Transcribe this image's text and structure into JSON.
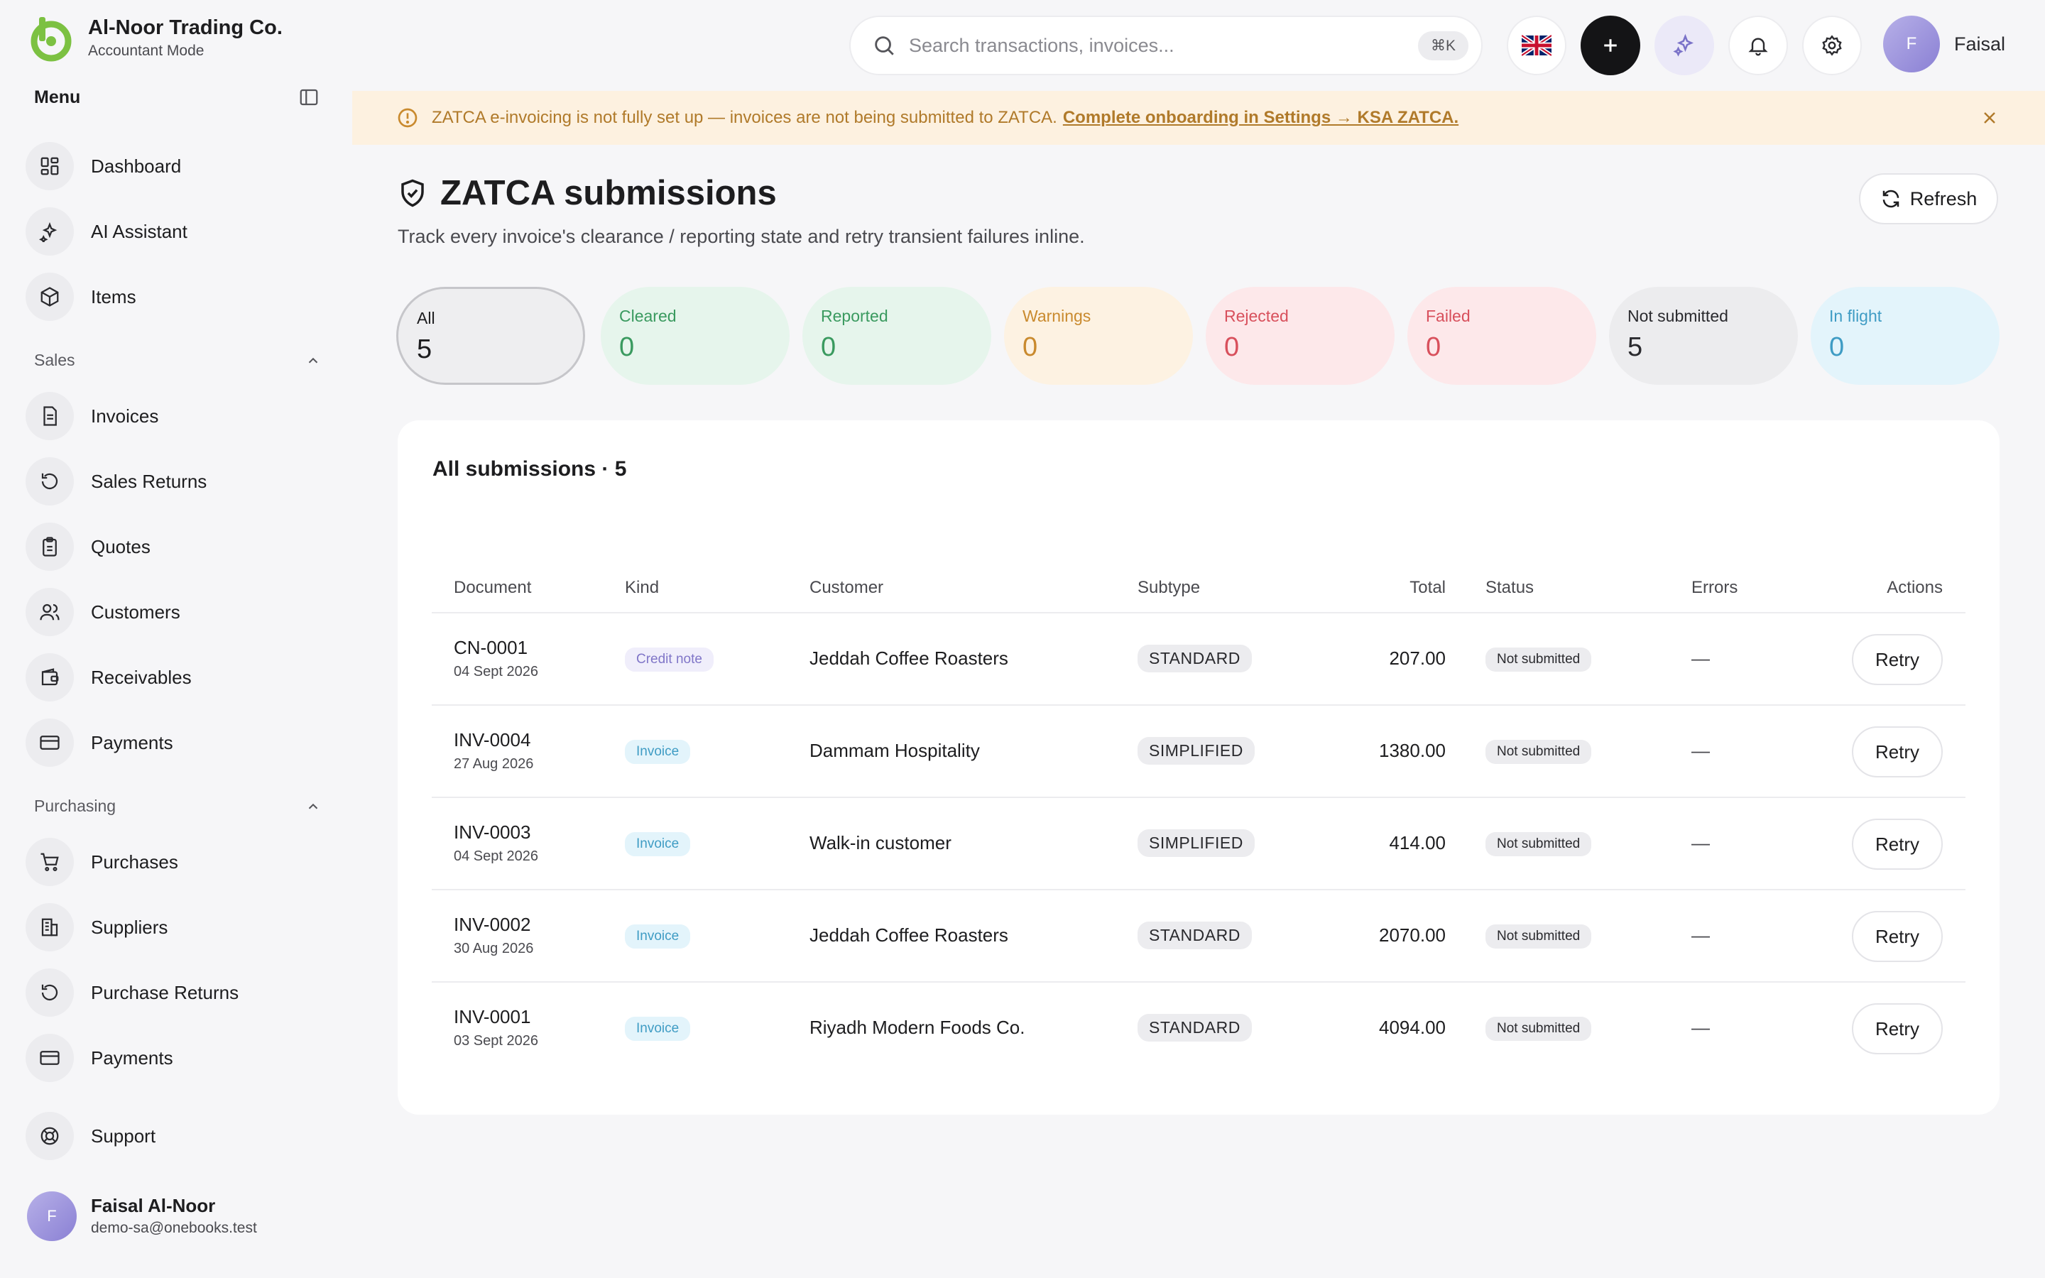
{
  "brand": {
    "name": "Al-Noor Trading Co.",
    "mode": "Accountant Mode"
  },
  "menu": {
    "title": "Menu"
  },
  "nav": {
    "main": [
      {
        "label": "Dashboard",
        "icon": "dashboard-icon"
      },
      {
        "label": "AI Assistant",
        "icon": "sparkle-icon"
      },
      {
        "label": "Items",
        "icon": "box-icon"
      }
    ],
    "sales": {
      "label": "Sales",
      "items": [
        {
          "label": "Invoices",
          "icon": "document-icon"
        },
        {
          "label": "Sales Returns",
          "icon": "return-icon"
        },
        {
          "label": "Quotes",
          "icon": "clipboard-icon"
        },
        {
          "label": "Customers",
          "icon": "users-icon"
        },
        {
          "label": "Receivables",
          "icon": "wallet-icon"
        },
        {
          "label": "Payments",
          "icon": "card-icon"
        }
      ]
    },
    "purchasing": {
      "label": "Purchasing",
      "items": [
        {
          "label": "Purchases",
          "icon": "cart-icon"
        },
        {
          "label": "Suppliers",
          "icon": "building-icon"
        },
        {
          "label": "Purchase Returns",
          "icon": "return-icon"
        },
        {
          "label": "Payments",
          "icon": "card-icon"
        }
      ]
    },
    "support": {
      "label": "Support",
      "icon": "lifebuoy-icon"
    }
  },
  "user": {
    "initial": "F",
    "name": "Faisal Al-Noor",
    "email": "demo-sa@onebooks.test"
  },
  "topbar": {
    "search_placeholder": "Search transactions, invoices...",
    "shortcut": "⌘K",
    "profile_initial": "F",
    "profile_name": "Faisal"
  },
  "banner": {
    "text": "ZATCA e-invoicing is not fully set up — invoices are not being submitted to ZATCA.",
    "link": "Complete onboarding in Settings → KSA ZATCA."
  },
  "page": {
    "title": "ZATCA submissions",
    "description": "Track every invoice's clearance / reporting state and retry transient failures inline.",
    "refresh_label": "Refresh"
  },
  "filters": [
    {
      "label": "All",
      "count": "5"
    },
    {
      "label": "Cleared",
      "count": "0"
    },
    {
      "label": "Reported",
      "count": "0"
    },
    {
      "label": "Warnings",
      "count": "0"
    },
    {
      "label": "Rejected",
      "count": "0"
    },
    {
      "label": "Failed",
      "count": "0"
    },
    {
      "label": "Not submitted",
      "count": "5"
    },
    {
      "label": "In flight",
      "count": "0"
    }
  ],
  "table": {
    "title": "All submissions · 5",
    "columns": [
      "Document",
      "Kind",
      "Customer",
      "Subtype",
      "Total",
      "Status",
      "Errors",
      "Actions"
    ],
    "rows": [
      {
        "doc": "CN-0001",
        "date": "04 Sept 2026",
        "kind": "Credit note",
        "customer": "Jeddah Coffee Roasters",
        "subtype": "STANDARD",
        "total": "207.00",
        "status": "Not submitted",
        "errors": "—",
        "action": "Retry"
      },
      {
        "doc": "INV-0004",
        "date": "27 Aug 2026",
        "kind": "Invoice",
        "customer": "Dammam Hospitality",
        "subtype": "SIMPLIFIED",
        "total": "1380.00",
        "status": "Not submitted",
        "errors": "—",
        "action": "Retry"
      },
      {
        "doc": "INV-0003",
        "date": "04 Sept 2026",
        "kind": "Invoice",
        "customer": "Walk-in customer",
        "subtype": "SIMPLIFIED",
        "total": "414.00",
        "status": "Not submitted",
        "errors": "—",
        "action": "Retry"
      },
      {
        "doc": "INV-0002",
        "date": "30 Aug 2026",
        "kind": "Invoice",
        "customer": "Jeddah Coffee Roasters",
        "subtype": "STANDARD",
        "total": "2070.00",
        "status": "Not submitted",
        "errors": "—",
        "action": "Retry"
      },
      {
        "doc": "INV-0001",
        "date": "03 Sept 2026",
        "kind": "Invoice",
        "customer": "Riyadh Modern Foods Co.",
        "subtype": "STANDARD",
        "total": "4094.00",
        "status": "Not submitted",
        "errors": "—",
        "action": "Retry"
      }
    ]
  },
  "colors": {
    "brand_green": "#7cc142",
    "banner_text": "#b07a2a",
    "accent_dark": "#141416"
  }
}
